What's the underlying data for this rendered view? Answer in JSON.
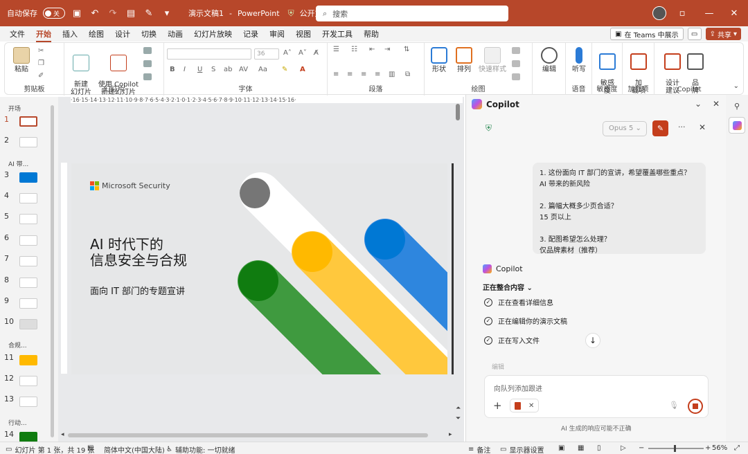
{
  "titlebar": {
    "autosave_label": "自动保存",
    "autosave_state": "关",
    "doc_name": "演示文稿1",
    "separator": "-",
    "app_name": "PowerPoint",
    "sensitivity_label": "公开文档*",
    "search_placeholder": "搜索",
    "brand_color": "#b7472a"
  },
  "menu": {
    "tabs": [
      "文件",
      "开始",
      "插入",
      "绘图",
      "设计",
      "切换",
      "动画",
      "幻灯片放映",
      "记录",
      "审阅",
      "视图",
      "开发工具",
      "帮助"
    ],
    "active_tab": "开始",
    "teams_button": "在 Teams 中展示",
    "share_button": "共享"
  },
  "ribbon": {
    "clipboard": {
      "label": "剪贴板",
      "paste": "粘贴"
    },
    "slides": {
      "label": "幻灯片",
      "new_slide": "新建\n幻灯片",
      "copilot_slide": "使用 Copilot\n新建幻灯片"
    },
    "font": {
      "label": "字体",
      "size": "36"
    },
    "paragraph": {
      "label": "段落"
    },
    "drawing": {
      "label": "绘图",
      "shapes": "形状",
      "arrange": "排列",
      "quick_styles": "快速样式"
    },
    "editing": {
      "label": "编辑"
    },
    "voice": {
      "label": "语音",
      "dictate": "听写"
    },
    "sensitivity": {
      "label": "敏感度",
      "btn": "敏感\n度"
    },
    "addins": {
      "label": "加载项",
      "btn": "加\n载项"
    },
    "copilot": {
      "label": "Copilot",
      "designer": "设计\n建议",
      "brand": "品\n牌"
    }
  },
  "thumbnails": {
    "sections": [
      "开场",
      "AI 带...",
      "合规...",
      "行动..."
    ],
    "slides": [
      "1",
      "2",
      "3",
      "4",
      "5",
      "6",
      "7",
      "8",
      "9",
      "10",
      "11",
      "12",
      "13",
      "14"
    ],
    "selected": "1"
  },
  "ruler": {
    "horizontal": "·16·15·14·13·12·11·10·9·8·7·6·5·4·3·2·1·0·1·2·3·4·5·6·7·8·9·10·11·12·13·14·15·16·"
  },
  "slide": {
    "brand": "Microsoft Security",
    "title": "AI 时代下的\n信息安全与合规",
    "subtitle": "面向 IT 部门的专题宣讲",
    "colors": {
      "gray": "#767676",
      "yellow": "#ffb900",
      "blue": "#0078d4",
      "green": "#107c10",
      "white": "#ffffff"
    }
  },
  "copilot": {
    "title": "Copilot",
    "model": "Opus 5",
    "user_message": "1. 这份面向 IT 部门的宣讲，希望覆盖哪些重点？\nAI 带来的新风险\n\n2. 篇幅大概多少页合适？\n15 页以上\n\n3. 配图希望怎么处理？\n仅品牌素材（推荐）",
    "assistant_name": "Copilot",
    "status": "正在整合内容",
    "steps": [
      "正在查看详细信息",
      "正在编辑你的演示文稿",
      "正在写入文件"
    ],
    "edit_hint": "编辑",
    "input_placeholder": "向队列添加跟进",
    "disclaimer": "AI 生成的响应可能不正确"
  },
  "statusbar": {
    "slide_info": "幻灯片 第 1 张，共 19 张",
    "language": "简体中文(中国大陆)",
    "accessibility": "辅助功能: 一切就绪",
    "notes": "备注",
    "display_settings": "显示器设置",
    "zoom": "56%"
  }
}
